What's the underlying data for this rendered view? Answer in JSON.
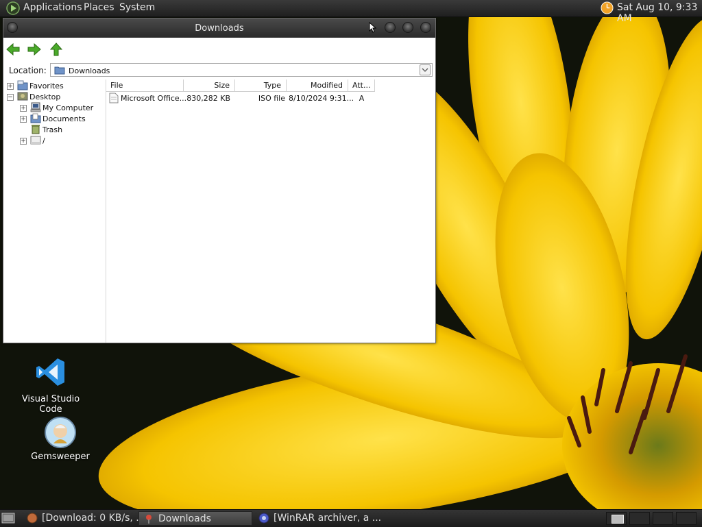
{
  "top_panel": {
    "menus": [
      "Applications",
      "Places",
      "System"
    ],
    "clock": "Sat Aug 10,  9:33 AM"
  },
  "window": {
    "title": "Downloads",
    "location_label": "Location:",
    "location_value": "Downloads"
  },
  "tree": {
    "items": [
      "Favorites",
      "Desktop",
      "My Computer",
      "Documents",
      "Trash",
      "/"
    ]
  },
  "filelist": {
    "columns": [
      "File",
      "Size",
      "Type",
      "Modified",
      "Att..."
    ],
    "rows": [
      {
        "file": "Microsoft Office...",
        "size": "830,282 KB",
        "type": "ISO file",
        "modified": "8/10/2024 9:31...",
        "att": "A"
      }
    ]
  },
  "desktop": {
    "icons": [
      "Visual Studio Code",
      "Gemsweeper"
    ]
  },
  "taskbar": {
    "tasks": [
      "[Download: 0 KB/s, ...",
      "Downloads",
      "[WinRAR archiver, a ..."
    ]
  },
  "colors": {
    "panel": "#2a2a2a",
    "window_title": "#3a3a3a",
    "nav_arrow": "#3f9b1e",
    "folder": "#6f93c8"
  }
}
